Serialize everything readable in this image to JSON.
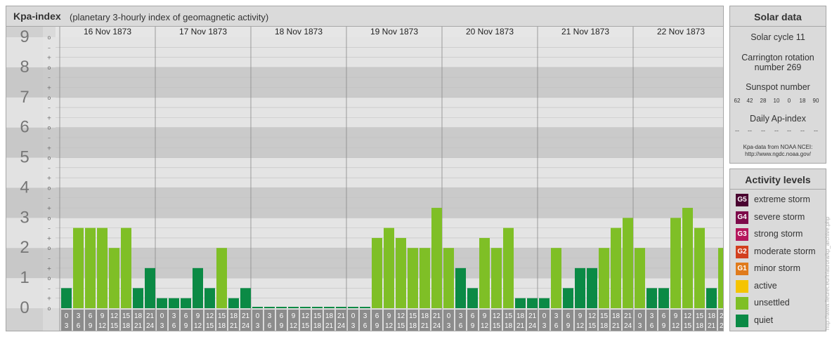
{
  "header": {
    "title": "Kpa-index",
    "subtitle": "(planetary 3-hourly index of geomagnetic activity)"
  },
  "chart_data": {
    "type": "bar",
    "title": "Kpa-index",
    "subtitle": "(planetary 3-hourly index of geomagnetic activity)",
    "ylim": [
      0,
      9
    ],
    "y_ticks": [
      "0",
      "1",
      "2",
      "3",
      "4",
      "5",
      "6",
      "7",
      "8",
      "9"
    ],
    "y_minor_ticks": [
      "o",
      "+",
      "–",
      "o",
      "+",
      "–",
      "o",
      "+",
      "–",
      "o",
      "+",
      "–",
      "o",
      "+",
      "–",
      "o",
      "+",
      "–",
      "o",
      "+",
      "–",
      "o",
      "+",
      "–",
      "o",
      "+",
      "–",
      "o"
    ],
    "days": [
      "16 Nov 1873",
      "17 Nov 1873",
      "18 Nov 1873",
      "19 Nov 1873",
      "20 Nov 1873",
      "21 Nov 1873",
      "22 Nov 1873"
    ],
    "intervals": [
      [
        "0",
        "3"
      ],
      [
        "3",
        "6"
      ],
      [
        "6",
        "9"
      ],
      [
        "9",
        "12"
      ],
      [
        "12",
        "15"
      ],
      [
        "15",
        "18"
      ],
      [
        "18",
        "21"
      ],
      [
        "21",
        "24"
      ]
    ],
    "values": [
      [
        0.667,
        2.667,
        2.667,
        2.667,
        2.0,
        2.667,
        0.667,
        1.333
      ],
      [
        0.333,
        0.333,
        0.333,
        1.333,
        0.667,
        2.0,
        0.333,
        0.667
      ],
      [
        0,
        0,
        0,
        0,
        0,
        0,
        0,
        0
      ],
      [
        0,
        0,
        2.333,
        2.667,
        2.333,
        2.0,
        2.0,
        3.333
      ],
      [
        2.0,
        1.333,
        0.667,
        2.333,
        2.0,
        2.667,
        0.333,
        0.333
      ],
      [
        0.333,
        2.0,
        0.667,
        1.333,
        1.333,
        2.0,
        2.667,
        3.0
      ],
      [
        2.0,
        0.667,
        0.667,
        3.0,
        3.333,
        2.667,
        0.667,
        2.0
      ]
    ],
    "grid": true
  },
  "colors": {
    "quiet": "#0b8a45",
    "unsettled": "#7fbf26",
    "active": "#f5c400",
    "g1": "#e07b1c",
    "g2": "#d2401f",
    "g3": "#b5175c",
    "g4": "#7d0b4a",
    "g5": "#4a0330",
    "band_light": "#e4e4e4",
    "band_dark": "#cacaca",
    "gridline": "#c0c0c0"
  },
  "solar": {
    "title": "Solar data",
    "cycle": "Solar cycle 11",
    "carrington_line1": "Carrington rotation",
    "carrington_line2": "number 269",
    "sunspot_title": "Sunspot number",
    "sunspot_values": [
      "62",
      "42",
      "28",
      "10",
      "0",
      "18",
      "90"
    ],
    "ap_title": "Daily Ap-index",
    "ap_values": [
      "--",
      "--",
      "--",
      "--",
      "--",
      "--",
      "--"
    ],
    "source_line1": "Kpa-data from NOAA NCEI:",
    "source_line2": "http://www.ngdc.noaa.gov/"
  },
  "activity": {
    "title": "Activity levels",
    "levels": [
      {
        "code": "G5",
        "label": "extreme storm",
        "color": "#4a0330"
      },
      {
        "code": "G4",
        "label": "severe storm",
        "color": "#7d0b4a"
      },
      {
        "code": "G3",
        "label": "strong storm",
        "color": "#b5175c"
      },
      {
        "code": "G2",
        "label": "moderate storm",
        "color": "#d2401f"
      },
      {
        "code": "G1",
        "label": "minor storm",
        "color": "#e07b1c"
      },
      {
        "code": "",
        "label": "active",
        "color": "#f5c400"
      },
      {
        "code": "",
        "label": "unsettled",
        "color": "#7fbf26"
      },
      {
        "code": "",
        "label": "quiet",
        "color": "#0b8a45"
      }
    ]
  },
  "watermark": "http://www.fleuret.eu/fr/aurora/kp_archive.php"
}
